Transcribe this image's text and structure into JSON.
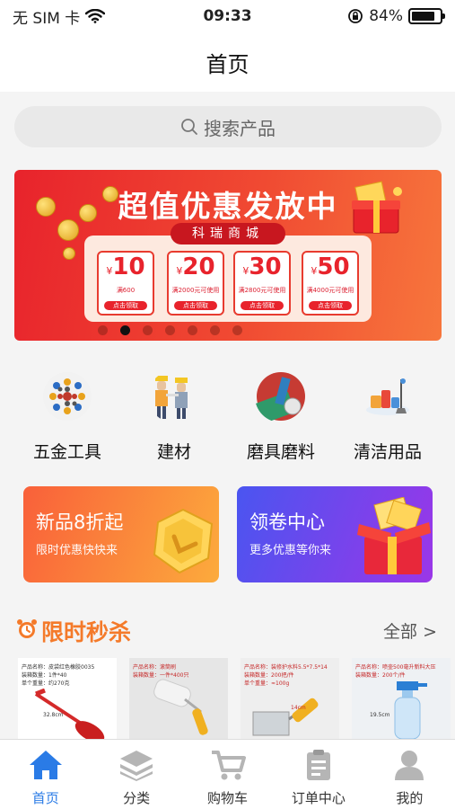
{
  "status_bar": {
    "carrier": "无 SIM 卡",
    "time": "09:33",
    "battery_percent": "84%",
    "battery_level": 0.84
  },
  "nav": {
    "title": "首页"
  },
  "search": {
    "placeholder": "搜索产品"
  },
  "banner": {
    "headline": "超值优惠发放中",
    "store_name": "科瑞商城",
    "coupons": [
      {
        "currency": "¥",
        "amount": "10",
        "condition": "满600",
        "action": "点击领取"
      },
      {
        "currency": "¥",
        "amount": "20",
        "condition": "满2000元可使用",
        "action": "点击领取"
      },
      {
        "currency": "¥",
        "amount": "30",
        "condition": "满2800元可使用",
        "action": "点击领取"
      },
      {
        "currency": "¥",
        "amount": "50",
        "condition": "满4000元可使用",
        "action": "点击领取"
      }
    ],
    "slide_count": 7,
    "active_slide": 1
  },
  "categories": [
    {
      "label": "五金工具",
      "icon": "hardware-tools-icon"
    },
    {
      "label": "建材",
      "icon": "building-materials-icon"
    },
    {
      "label": "磨具磨料",
      "icon": "abrasives-icon"
    },
    {
      "label": "清洁用品",
      "icon": "cleaning-supplies-icon"
    }
  ],
  "promos": [
    {
      "title": "新品8折起",
      "subtitle": "限时优惠快快来",
      "colors": [
        "#f9603a",
        "#fcab3c"
      ]
    },
    {
      "title": "领卷中心",
      "subtitle": "更多优惠等你来",
      "colors": [
        "#4a55f0",
        "#9b36e8"
      ]
    }
  ],
  "flash_sale": {
    "title": "限时秒杀",
    "more_label": "全部 >",
    "products": [
      {
        "spec_lines": [
          "产品名称：皮袋红色橡胶0035",
          "装箱数量：1件*40",
          "单个重量：约270克"
        ],
        "dimension": "32.8cm"
      },
      {
        "spec_lines": [
          "产品名称：滚筒刷",
          "装箱数量：一件*400只"
        ],
        "dimension": ""
      },
      {
        "spec_lines": [
          "产品名称：装修护水料5.5*7.5*14",
          "装箱数量：200把/件",
          "单个重量：≈100g"
        ],
        "dimension": "14cm"
      },
      {
        "spec_lines": [
          "产品名称：喷壶500毫升新料大压",
          "装箱数量：200个/件"
        ],
        "dimension": "19.5cm"
      }
    ]
  },
  "tabbar": [
    {
      "label": "首页",
      "icon": "home-icon",
      "active": true
    },
    {
      "label": "分类",
      "icon": "category-layers-icon",
      "active": false
    },
    {
      "label": "购物车",
      "icon": "cart-icon",
      "active": false
    },
    {
      "label": "订单中心",
      "icon": "order-clipboard-icon",
      "active": false
    },
    {
      "label": "我的",
      "icon": "profile-icon",
      "active": false
    }
  ],
  "colors": {
    "accent_blue": "#2a7be6",
    "flash_orange": "#f47a2a",
    "banner_red": "#e8232c"
  }
}
